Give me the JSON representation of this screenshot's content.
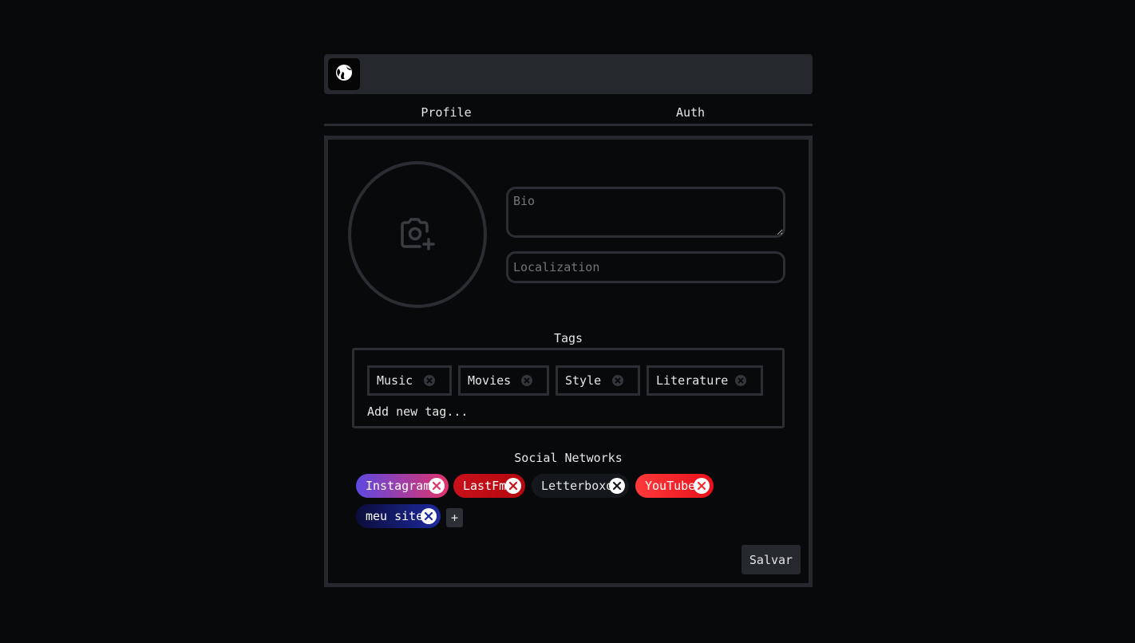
{
  "tabs": [
    {
      "label": "Profile"
    },
    {
      "label": "Auth"
    }
  ],
  "profile": {
    "bio_placeholder": "Bio",
    "localization_placeholder": "Localization"
  },
  "tags": {
    "title": "Tags",
    "items": [
      {
        "label": "Music"
      },
      {
        "label": "Movies"
      },
      {
        "label": "Style"
      },
      {
        "label": "Literature"
      }
    ],
    "add_label": "Add new tag..."
  },
  "social": {
    "title": "Social Networks",
    "items": [
      {
        "label": "Instagram",
        "gradient": [
          "#5e49e0",
          "#e0336c"
        ],
        "text_color": "#ffffff",
        "x_color": "#e0336c"
      },
      {
        "label": "LastFm",
        "gradient": [
          "#c8101a",
          "#b5080f"
        ],
        "text_color": "#ffffff",
        "x_color": "#c8101a"
      },
      {
        "label": "Letterboxd",
        "gradient": [
          "#14171c",
          "#14171c"
        ],
        "text_color": "#e6e6e6",
        "x_color": "#14171c"
      },
      {
        "label": "YouTube",
        "gradient": [
          "#ff3a3a",
          "#e8101a"
        ],
        "text_color": "#ffffff",
        "x_color": "#ff2a2a"
      },
      {
        "label": "meu site",
        "gradient": [
          "#0b0d3a",
          "#1d2a9e"
        ],
        "text_color": "#ffffff",
        "x_color": "#1d2a9e"
      }
    ],
    "add_label": "+"
  },
  "actions": {
    "save_label": "Salvar"
  },
  "colors": {
    "background": "#08090b",
    "panel_border": "#25282d",
    "topbar": "#25282d"
  }
}
